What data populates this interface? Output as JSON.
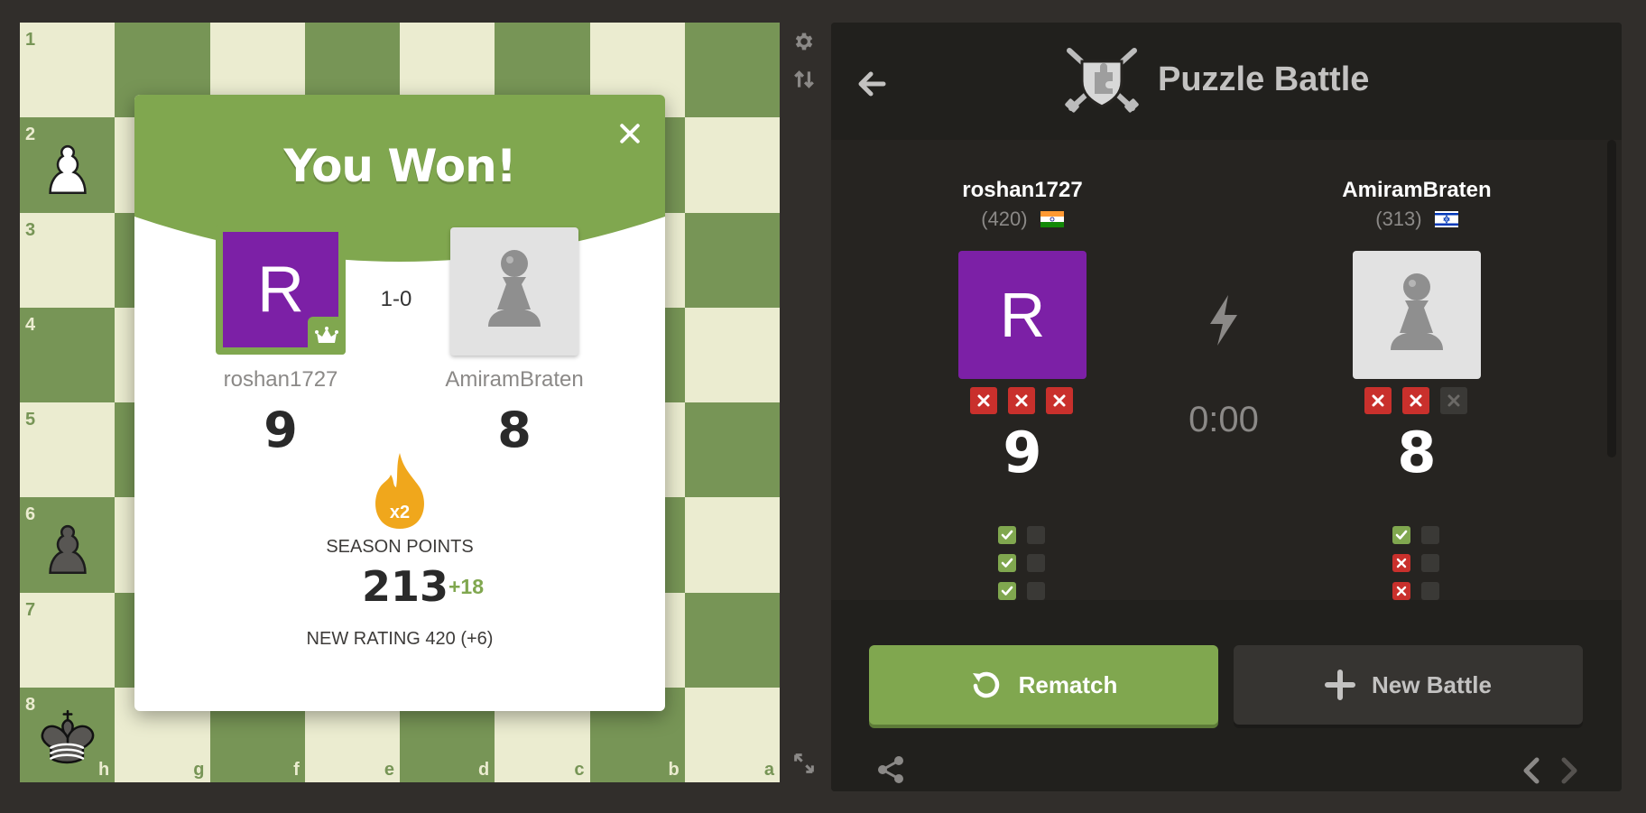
{
  "board": {
    "ranks": [
      "1",
      "2",
      "3",
      "4",
      "5",
      "6",
      "7",
      "8"
    ],
    "files": [
      "h",
      "g",
      "f",
      "e",
      "d",
      "c",
      "b",
      "a"
    ]
  },
  "modal": {
    "title": "You Won!",
    "close_label": "×",
    "player1": {
      "name": "roshan1727",
      "avatar_letter": "R",
      "score": "9"
    },
    "player2": {
      "name": "AmiramBraten",
      "score": "8"
    },
    "result": "1-0",
    "multiplier": "x2",
    "season_label": "SEASON POINTS",
    "season_points": "213",
    "season_delta": "+18",
    "new_rating": "NEW RATING 420 (+6)"
  },
  "panel": {
    "title": "Puzzle Battle",
    "player1": {
      "name": "roshan1727",
      "rating": "(420)",
      "avatar_letter": "R",
      "score": "9",
      "strikes": [
        true,
        true,
        true
      ],
      "results": [
        [
          "ok",
          "empty"
        ],
        [
          "ok",
          "empty"
        ],
        [
          "ok",
          "empty"
        ]
      ]
    },
    "player2": {
      "name": "AmiramBraten",
      "rating": "(313)",
      "score": "8",
      "strikes": [
        true,
        true,
        false
      ],
      "results": [
        [
          "ok",
          "empty"
        ],
        [
          "bad",
          "empty"
        ],
        [
          "bad",
          "empty"
        ]
      ]
    },
    "timer": "0:00",
    "rematch_label": "Rematch",
    "new_battle_label": "New Battle"
  },
  "colors": {
    "board_light": "#ebecd0",
    "board_dark": "#779556",
    "brand_green": "#80a74f",
    "avatar_purple": "#7c20a6",
    "strike_red": "#c9302c",
    "flame_orange": "#f0a71c"
  },
  "icons": {
    "settings": "gear-icon",
    "flip": "flip-board-icon",
    "back": "arrow-left-icon",
    "logo": "puzzle-battle-shield-icon",
    "bolt": "lightning-icon",
    "rematch": "rematch-icon",
    "new_battle": "plus-icon",
    "share": "share-icon",
    "prev": "chevron-left-icon",
    "next": "chevron-right-icon",
    "expand": "expand-icon"
  }
}
